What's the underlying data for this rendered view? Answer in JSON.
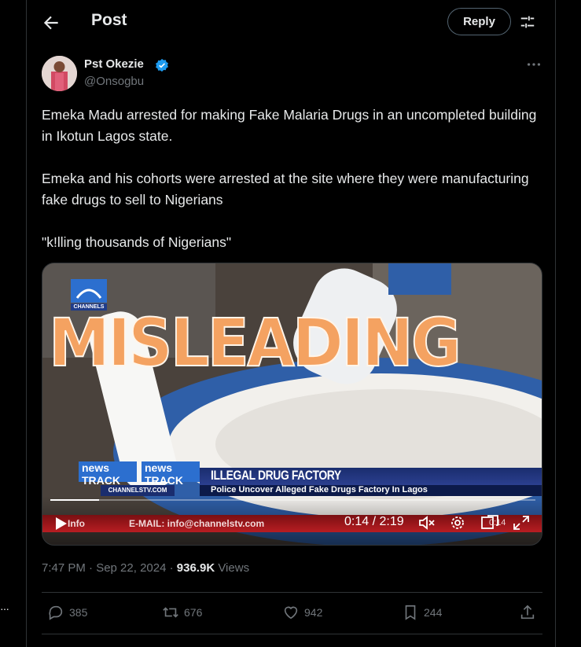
{
  "header": {
    "title": "Post",
    "reply_label": "Reply"
  },
  "author": {
    "name": "Pst Okezie",
    "handle": "@Onsogbu"
  },
  "tweet": {
    "paragraphs": [
      "Emeka Madu arrested for making Fake Malaria Drugs in an uncompleted building in Ikotun Lagos state.",
      "Emeka and his cohorts were arrested at the site where they were manufacturing fake drugs to sell to Nigerians",
      "\"k!lling thousands of Nigerians\""
    ]
  },
  "video": {
    "overlay_label": "MISLEADING",
    "channel_logo": "CHANNELS",
    "badge_1": "news TRACK",
    "badge_2": "news TRACK",
    "site": "CHANNELSTV.COM",
    "headline": "ILLEGAL DRUG FACTORY",
    "subheadline": "Police Uncover Alleged Fake Drugs Factory In Lagos",
    "ticker_info": "Info",
    "ticker": "E-MAIL: info@channelstv.com",
    "time": "0:14 / 2:19",
    "pip_time": "0:14",
    "progress": 0.1
  },
  "meta": {
    "time": "7:47 PM · Sep 22, 2024 · ",
    "views_count": "936.9K",
    "views_label": " Views"
  },
  "actions": {
    "replies": "385",
    "reposts": "676",
    "likes": "942",
    "bookmarks": "244"
  },
  "left_menu": "···"
}
